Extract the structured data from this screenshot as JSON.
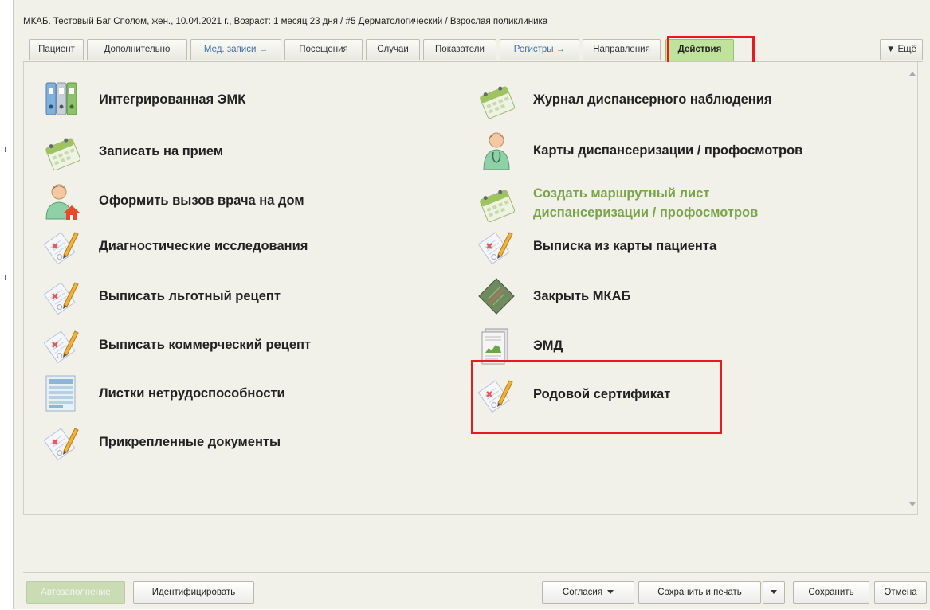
{
  "title": "МКАБ. Тестовый Баг Сполом, жен., 10.04.2021 г., Возраст: 1 месяц 23 дня / #5 Дерматологический / Взрослая поликлиника",
  "tabs": [
    {
      "label": "Пациент"
    },
    {
      "label": "Дополнительно"
    },
    {
      "label": "Мед. записи →"
    },
    {
      "label": "Посещения"
    },
    {
      "label": "Случаи"
    },
    {
      "label": "Показатели"
    },
    {
      "label": "Регистры →"
    },
    {
      "label": "Направления"
    },
    {
      "label": "Действия"
    }
  ],
  "more_label": "▼ Ещё",
  "actions_left": [
    {
      "label": "Интегрированная ЭМК",
      "icon": "binders-icon"
    },
    {
      "label": "Записать на прием",
      "icon": "calendar-icon"
    },
    {
      "label": "Оформить вызов врача на дом",
      "icon": "doctor-home-icon"
    },
    {
      "label": "Диагностические исследования",
      "icon": "document-pencil-icon"
    },
    {
      "label": "Выписать льготный рецепт",
      "icon": "document-pencil-icon"
    },
    {
      "label": "Выписать коммерческий рецепт",
      "icon": "document-pencil-icon"
    },
    {
      "label": "Листки нетрудоспособности",
      "icon": "form-icon"
    },
    {
      "label": "Прикрепленные документы",
      "icon": "document-pencil-icon"
    }
  ],
  "actions_right": [
    {
      "label": "Журнал диспансерного наблюдения",
      "icon": "calendar-icon"
    },
    {
      "label": "Карты диспансеризации / профосмотров",
      "icon": "doctor-icon"
    },
    {
      "label": "Создать маршрутный лист",
      "label2": "диспансеризации / профосмотров",
      "icon": "calendar-icon"
    },
    {
      "label": "Выписка из карты пациента",
      "icon": "document-pencil-icon"
    },
    {
      "label": "Закрыть МКАБ",
      "icon": "closed-book-icon"
    },
    {
      "label": "ЭМД",
      "icon": "report-icon"
    },
    {
      "label": "Родовой сертификат",
      "icon": "document-pencil-icon"
    }
  ],
  "buttons": {
    "autofill": "Автозаполнение",
    "identify": "Идентифицировать",
    "consents": "Согласия",
    "save_print": "Сохранить и печать",
    "save": "Сохранить",
    "cancel": "Отмена"
  },
  "colors": {
    "accent_tab": "#bfe39a",
    "highlight": "#e8191f",
    "disabled_label": "#79a548",
    "link_tab": "#3b6ea8"
  }
}
